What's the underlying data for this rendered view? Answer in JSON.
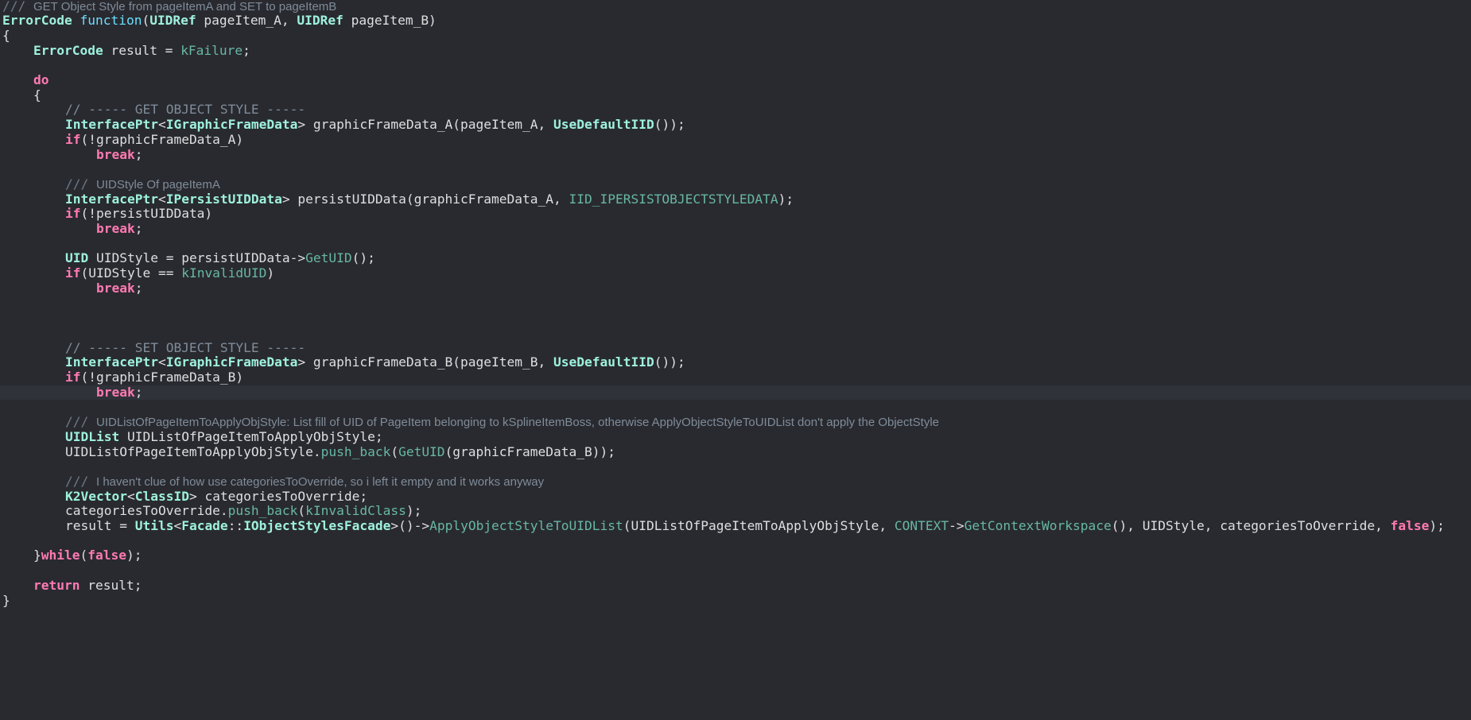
{
  "editor": {
    "colors": {
      "background": "#292a30",
      "current_line": "#2f3239",
      "keyword": "#ff7ab2",
      "type": "#9ef1dd",
      "function_keyword": "#6bdfff",
      "identifier": "#67b7a4",
      "comment": "#7f8c98",
      "plain": "#dfdfe0"
    },
    "current_line_index": 26,
    "lines": [
      {
        "indent": 0,
        "tokens": [
          {
            "t": "/// ",
            "c": "docmark"
          },
          {
            "t": "GET Object Style from pageItemA and SET to pageItemB",
            "c": "doc"
          }
        ]
      },
      {
        "indent": 0,
        "tokens": [
          {
            "t": "ErrorCode",
            "c": "type"
          },
          {
            "t": " ",
            "c": "plain"
          },
          {
            "t": "function",
            "c": "fnkw"
          },
          {
            "t": "(",
            "c": "plain"
          },
          {
            "t": "UIDRef",
            "c": "type"
          },
          {
            "t": " pageItem_A, ",
            "c": "plain"
          },
          {
            "t": "UIDRef",
            "c": "type"
          },
          {
            "t": " pageItem_B)",
            "c": "plain"
          }
        ]
      },
      {
        "indent": 0,
        "tokens": [
          {
            "t": "{",
            "c": "plain"
          }
        ]
      },
      {
        "indent": 1,
        "tokens": [
          {
            "t": "ErrorCode",
            "c": "type"
          },
          {
            "t": " result = ",
            "c": "plain"
          },
          {
            "t": "kFailure",
            "c": "green"
          },
          {
            "t": ";",
            "c": "plain"
          }
        ]
      },
      {
        "indent": 0,
        "tokens": []
      },
      {
        "indent": 1,
        "tokens": [
          {
            "t": "do",
            "c": "kw"
          }
        ]
      },
      {
        "indent": 1,
        "tokens": [
          {
            "t": "{",
            "c": "plain"
          }
        ]
      },
      {
        "indent": 2,
        "tokens": [
          {
            "t": "// ----- GET OBJECT STYLE -----",
            "c": "cmt"
          }
        ]
      },
      {
        "indent": 2,
        "tokens": [
          {
            "t": "InterfacePtr",
            "c": "type"
          },
          {
            "t": "<",
            "c": "plain"
          },
          {
            "t": "IGraphicFrameData",
            "c": "type"
          },
          {
            "t": "> graphicFrameData_A(pageItem_A, ",
            "c": "plain"
          },
          {
            "t": "UseDefaultIID",
            "c": "type"
          },
          {
            "t": "());",
            "c": "plain"
          }
        ]
      },
      {
        "indent": 2,
        "tokens": [
          {
            "t": "if",
            "c": "kw"
          },
          {
            "t": "(!graphicFrameData_A)",
            "c": "plain"
          }
        ]
      },
      {
        "indent": 3,
        "tokens": [
          {
            "t": "break",
            "c": "kw"
          },
          {
            "t": ";",
            "c": "plain"
          }
        ]
      },
      {
        "indent": 0,
        "tokens": []
      },
      {
        "indent": 2,
        "tokens": [
          {
            "t": "/// ",
            "c": "docmark"
          },
          {
            "t": "UIDStyle Of pageItemA",
            "c": "doc"
          }
        ]
      },
      {
        "indent": 2,
        "tokens": [
          {
            "t": "InterfacePtr",
            "c": "type"
          },
          {
            "t": "<",
            "c": "plain"
          },
          {
            "t": "IPersistUIDData",
            "c": "type"
          },
          {
            "t": "> persistUIDData(graphicFrameData_A, ",
            "c": "plain"
          },
          {
            "t": "IID_IPERSISTOBJECTSTYLEDATA",
            "c": "green"
          },
          {
            "t": ");",
            "c": "plain"
          }
        ]
      },
      {
        "indent": 2,
        "tokens": [
          {
            "t": "if",
            "c": "kw"
          },
          {
            "t": "(!persistUIDData)",
            "c": "plain"
          }
        ]
      },
      {
        "indent": 3,
        "tokens": [
          {
            "t": "break",
            "c": "kw"
          },
          {
            "t": ";",
            "c": "plain"
          }
        ]
      },
      {
        "indent": 0,
        "tokens": []
      },
      {
        "indent": 2,
        "tokens": [
          {
            "t": "UID",
            "c": "type"
          },
          {
            "t": " UIDStyle = persistUIDData->",
            "c": "plain"
          },
          {
            "t": "GetUID",
            "c": "green"
          },
          {
            "t": "();",
            "c": "plain"
          }
        ]
      },
      {
        "indent": 2,
        "tokens": [
          {
            "t": "if",
            "c": "kw"
          },
          {
            "t": "(UIDStyle == ",
            "c": "plain"
          },
          {
            "t": "kInvalidUID",
            "c": "green"
          },
          {
            "t": ")",
            "c": "plain"
          }
        ]
      },
      {
        "indent": 3,
        "tokens": [
          {
            "t": "break",
            "c": "kw"
          },
          {
            "t": ";",
            "c": "plain"
          }
        ]
      },
      {
        "indent": 0,
        "tokens": []
      },
      {
        "indent": 0,
        "tokens": []
      },
      {
        "indent": 0,
        "tokens": []
      },
      {
        "indent": 2,
        "tokens": [
          {
            "t": "// ----- SET OBJECT STYLE -----",
            "c": "cmt"
          }
        ]
      },
      {
        "indent": 2,
        "tokens": [
          {
            "t": "InterfacePtr",
            "c": "type"
          },
          {
            "t": "<",
            "c": "plain"
          },
          {
            "t": "IGraphicFrameData",
            "c": "type"
          },
          {
            "t": "> graphicFrameData_B(pageItem_B, ",
            "c": "plain"
          },
          {
            "t": "UseDefaultIID",
            "c": "type"
          },
          {
            "t": "());",
            "c": "plain"
          }
        ]
      },
      {
        "indent": 2,
        "tokens": [
          {
            "t": "if",
            "c": "kw"
          },
          {
            "t": "(!graphicFrameData_B)",
            "c": "plain"
          }
        ]
      },
      {
        "indent": 3,
        "tokens": [
          {
            "t": "break",
            "c": "kw"
          },
          {
            "t": ";",
            "c": "plain"
          }
        ]
      },
      {
        "indent": 0,
        "tokens": []
      },
      {
        "indent": 2,
        "tokens": [
          {
            "t": "/// ",
            "c": "docmark"
          },
          {
            "t": "UIDListOfPageItemToApplyObjStyle: List fill of UID of PageItem belonging to kSplineItemBoss, otherwise ApplyObjectStyleToUIDList don't apply the ObjectStyle",
            "c": "doc"
          }
        ]
      },
      {
        "indent": 2,
        "tokens": [
          {
            "t": "UIDList",
            "c": "type"
          },
          {
            "t": " UIDListOfPageItemToApplyObjStyle;",
            "c": "plain"
          }
        ]
      },
      {
        "indent": 2,
        "tokens": [
          {
            "t": "UIDListOfPageItemToApplyObjStyle.",
            "c": "plain"
          },
          {
            "t": "push_back",
            "c": "green"
          },
          {
            "t": "(",
            "c": "plain"
          },
          {
            "t": "GetUID",
            "c": "green"
          },
          {
            "t": "(graphicFrameData_B));",
            "c": "plain"
          }
        ]
      },
      {
        "indent": 0,
        "tokens": []
      },
      {
        "indent": 2,
        "tokens": [
          {
            "t": "/// ",
            "c": "docmark"
          },
          {
            "t": "I haven't clue of how use categoriesToOverride, so i left it empty and it works anyway",
            "c": "doc"
          }
        ]
      },
      {
        "indent": 2,
        "tokens": [
          {
            "t": "K2Vector",
            "c": "type"
          },
          {
            "t": "<",
            "c": "plain"
          },
          {
            "t": "ClassID",
            "c": "type"
          },
          {
            "t": "> categoriesToOverride;",
            "c": "plain"
          }
        ]
      },
      {
        "indent": 2,
        "tokens": [
          {
            "t": "categoriesToOverride.",
            "c": "plain"
          },
          {
            "t": "push_back",
            "c": "green"
          },
          {
            "t": "(",
            "c": "plain"
          },
          {
            "t": "kInvalidClass",
            "c": "green"
          },
          {
            "t": ");",
            "c": "plain"
          }
        ]
      },
      {
        "indent": 2,
        "tokens": [
          {
            "t": "result = ",
            "c": "plain"
          },
          {
            "t": "Utils",
            "c": "type"
          },
          {
            "t": "<",
            "c": "plain"
          },
          {
            "t": "Facade",
            "c": "type"
          },
          {
            "t": "::",
            "c": "plain"
          },
          {
            "t": "IObjectStylesFacade",
            "c": "type"
          },
          {
            "t": ">()->",
            "c": "plain"
          },
          {
            "t": "ApplyObjectStyleToUIDList",
            "c": "green"
          },
          {
            "t": "(UIDListOfPageItemToApplyObjStyle, ",
            "c": "plain"
          },
          {
            "t": "CONTEXT",
            "c": "green"
          },
          {
            "t": "->",
            "c": "plain"
          },
          {
            "t": "GetContextWorkspace",
            "c": "green"
          },
          {
            "t": "(), UIDStyle, categoriesToOverride, ",
            "c": "plain"
          },
          {
            "t": "false",
            "c": "kw"
          },
          {
            "t": ");",
            "c": "plain"
          }
        ]
      },
      {
        "indent": 0,
        "tokens": []
      },
      {
        "indent": 1,
        "tokens": [
          {
            "t": "}",
            "c": "plain"
          },
          {
            "t": "while",
            "c": "kw"
          },
          {
            "t": "(",
            "c": "plain"
          },
          {
            "t": "false",
            "c": "kw"
          },
          {
            "t": ");",
            "c": "plain"
          }
        ]
      },
      {
        "indent": 0,
        "tokens": []
      },
      {
        "indent": 1,
        "tokens": [
          {
            "t": "return",
            "c": "kw"
          },
          {
            "t": " result;",
            "c": "plain"
          }
        ]
      },
      {
        "indent": 0,
        "tokens": [
          {
            "t": "}",
            "c": "plain"
          }
        ]
      }
    ]
  }
}
